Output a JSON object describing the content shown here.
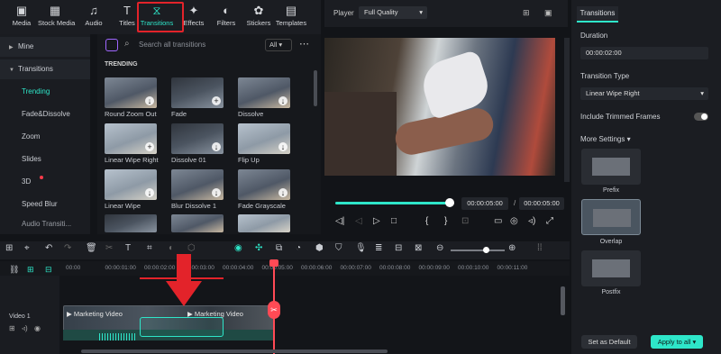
{
  "toolbar": {
    "items": [
      {
        "label": "Media",
        "icon": "media-icon"
      },
      {
        "label": "Stock Media",
        "icon": "stock-media-icon"
      },
      {
        "label": "Audio",
        "icon": "audio-icon"
      },
      {
        "label": "Titles",
        "icon": "titles-icon"
      },
      {
        "label": "Transitions",
        "icon": "transitions-icon",
        "active": true
      },
      {
        "label": "Effects",
        "icon": "effects-icon"
      },
      {
        "label": "Filters",
        "icon": "filters-icon"
      },
      {
        "label": "Stickers",
        "icon": "stickers-icon"
      },
      {
        "label": "Templates",
        "icon": "templates-icon"
      }
    ],
    "accent_color": "#2ee6c9",
    "highlight_color": "#e3232a"
  },
  "sidebar": {
    "items": [
      {
        "label": "Mine"
      },
      {
        "label": "Transitions"
      },
      {
        "label": "Trending"
      },
      {
        "label": "Fade&Dissolve"
      },
      {
        "label": "Zoom"
      },
      {
        "label": "Slides"
      },
      {
        "label": "3D"
      },
      {
        "label": "Speed Blur"
      },
      {
        "label": "Audio Transiti..."
      }
    ]
  },
  "search": {
    "placeholder": "Search all transitions",
    "filter_label": "All"
  },
  "section_title": "TRENDING",
  "transitions": [
    {
      "label": "Round Zoom Out"
    },
    {
      "label": "Fade"
    },
    {
      "label": "Dissolve"
    },
    {
      "label": "Linear Wipe Right"
    },
    {
      "label": "Dissolve 01"
    },
    {
      "label": "Flip Up"
    },
    {
      "label": "Linear Wipe"
    },
    {
      "label": "Blur Dissolve 1"
    },
    {
      "label": "Fade Grayscale"
    }
  ],
  "player": {
    "title": "Player",
    "quality": "Full Quality",
    "current_time": "00:00:05:00",
    "total_time": "00:00:05:00",
    "progress": 1.0
  },
  "properties": {
    "tab": "Transitions",
    "duration_label": "Duration",
    "duration_value": "00:00:02:00",
    "type_label": "Transition Type",
    "type_value": "Linear Wipe Right",
    "include_trimmed_label": "Include Trimmed Frames",
    "include_trimmed_on": false,
    "more_settings_label": "More Settings",
    "presets": [
      {
        "label": "Prefix"
      },
      {
        "label": "Overlap",
        "selected": true
      },
      {
        "label": "Postfix"
      }
    ],
    "set_default_label": "Set as Default",
    "apply_all_label": "Apply to all"
  },
  "timeline": {
    "ruler": [
      "00:00",
      "00:00:01:00",
      "00:00:02:00",
      "00:00:03:00",
      "00:00:04:00",
      "00:00:05:00",
      "00:00:06:00",
      "00:00:07:00",
      "00:00:08:00",
      "00:00:09:00",
      "00:00:10:00",
      "00:00:11:00"
    ],
    "track_label": "Video 1",
    "clips": [
      {
        "label": "Marketing Video"
      },
      {
        "label": "Marketing Video"
      }
    ]
  }
}
